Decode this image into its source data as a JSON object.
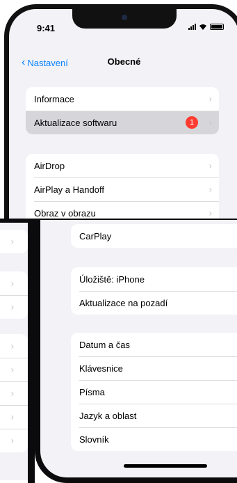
{
  "status": {
    "time": "9:41"
  },
  "nav": {
    "back_label": "Nastavení",
    "title": "Obecné"
  },
  "group1": [
    {
      "label": "Informace"
    },
    {
      "label": "Aktualizace softwaru",
      "badge": "1"
    }
  ],
  "group2": [
    {
      "label": "AirDrop"
    },
    {
      "label": "AirPlay a Handoff"
    },
    {
      "label": "Obraz v obrazu"
    }
  ],
  "lower": {
    "carplay": "CarPlay",
    "storage": "Úložiště: iPhone",
    "bg_refresh": "Aktualizace na pozadí",
    "datetime": "Datum a čas",
    "keyboard": "Klávesnice",
    "fonts": "Písma",
    "language": "Jazyk a oblast",
    "dictionary": "Slovník"
  }
}
